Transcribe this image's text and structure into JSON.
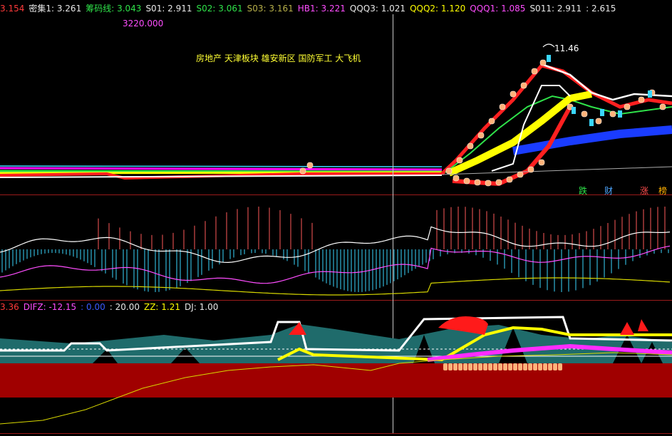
{
  "header": {
    "items": [
      {
        "label": "3.154",
        "color": "#ff3a3a"
      },
      {
        "label": "密集1: 3.261",
        "color": "#e8e8e8"
      },
      {
        "label": "筹码线: 3.043",
        "color": "#2fe34a"
      },
      {
        "label": "S01: 2.911",
        "color": "#e8e8e8"
      },
      {
        "label": "S02: 3.061",
        "color": "#2fe34a"
      },
      {
        "label": "S03: 3.161",
        "color": "#b7b04a"
      },
      {
        "label": "HB1: 3.221",
        "color": "#ff4dff"
      },
      {
        "label": "QQQ3: 1.021",
        "color": "#e8e8e8"
      },
      {
        "label": "QQQ2: 1.120",
        "color": "#ffff00"
      },
      {
        "label": "QQQ1: 1.085",
        "color": "#ff4dff"
      },
      {
        "label": "S011: 2.911",
        "color": "#e8e8e8"
      },
      {
        "label": ": 2.615",
        "color": "#e8e8e8"
      }
    ],
    "sub_value": "3220.000"
  },
  "main": {
    "sectors": "房地产 天津板块 雄安新区 国防军工 大飞机",
    "peak_label": "11.46",
    "bottom_tags": [
      {
        "text": "跌",
        "color": "#2fe34a"
      },
      {
        "text": "财",
        "color": "#4da6ff"
      },
      {
        "text": "涨",
        "color": "#ff4d4d"
      },
      {
        "text": "榜",
        "color": "#ffb000"
      }
    ]
  },
  "indicator": {
    "items": [
      {
        "label": "3.36",
        "color": "#ff3a3a"
      },
      {
        "label": "DIFZ: -12.15",
        "color": "#ff4dff"
      },
      {
        "label": ": 0.00",
        "color": "#3a5bff"
      },
      {
        "label": ": 20.00",
        "color": "#e8e8e8"
      },
      {
        "label": "ZZ: 1.21",
        "color": "#ffff00"
      },
      {
        "label": "DJ: 1.00",
        "color": "#e8e8e8"
      }
    ]
  },
  "colors": {
    "background": "#000000",
    "divider": "#9b1b1b",
    "crosshair": "#c8c8c8",
    "teal_area": "#1f6b6b",
    "red_band": "#a00000"
  }
}
